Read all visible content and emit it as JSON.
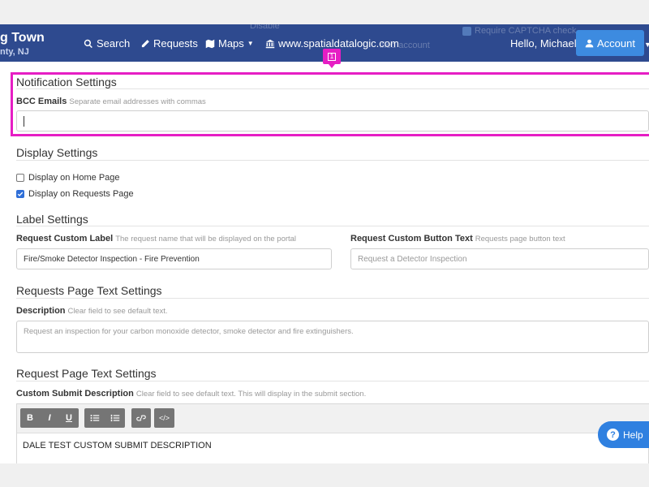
{
  "navbar": {
    "brand_title": "g Town",
    "brand_sub": "nty, NJ",
    "items": {
      "search": "Search",
      "requests": "Requests",
      "maps": "Maps",
      "website": "www.spatialdatalogic.com"
    },
    "greeting": "Hello, Michael",
    "account_label": "Account",
    "ghost_text": {
      "line1": "Disable",
      "line2": "Require CAPTCHA check",
      "line3": "ified account"
    }
  },
  "highlight": {
    "badge": "1",
    "color": "#e61ec4"
  },
  "notification": {
    "title": "Notification Settings",
    "bcc_label": "BCC Emails",
    "bcc_hint": "Separate email addresses with commas",
    "bcc_value": ""
  },
  "display": {
    "title": "Display Settings",
    "options": [
      {
        "label": "Display on Home Page",
        "checked": false
      },
      {
        "label": "Display on Requests Page",
        "checked": true
      }
    ]
  },
  "label_settings": {
    "title": "Label Settings",
    "custom_label": "Request Custom Label",
    "custom_label_hint": "The request name that will be displayed on the portal",
    "custom_label_value": "Fire/Smoke Detector Inspection - Fire Prevention",
    "button_label": "Request Custom Button Text",
    "button_hint": "Requests page button text",
    "button_placeholder": "Request a Detector Inspection"
  },
  "requests_page": {
    "title": "Requests Page Text Settings",
    "desc_label": "Description",
    "desc_hint": "Clear field to see default text.",
    "desc_placeholder": "Request an inspection for your carbon monoxide detector, smoke detector and fire extinguishers."
  },
  "request_page": {
    "title": "Request Page Text Settings",
    "submit_label": "Custom Submit Description",
    "submit_hint": "Clear field to see default text. This will display in the submit section.",
    "toolbar": {
      "bold": "B",
      "italic": "I",
      "underline": "U",
      "code": "</>"
    },
    "editor_content": "DALE TEST CUSTOM SUBMIT DESCRIPTION"
  },
  "help": {
    "label": "Help",
    "q": "?"
  },
  "colors": {
    "navbar": "#2e4a8f",
    "account": "#3d8be0",
    "help": "#2f80e0",
    "checkbox": "#2f6fd8"
  }
}
